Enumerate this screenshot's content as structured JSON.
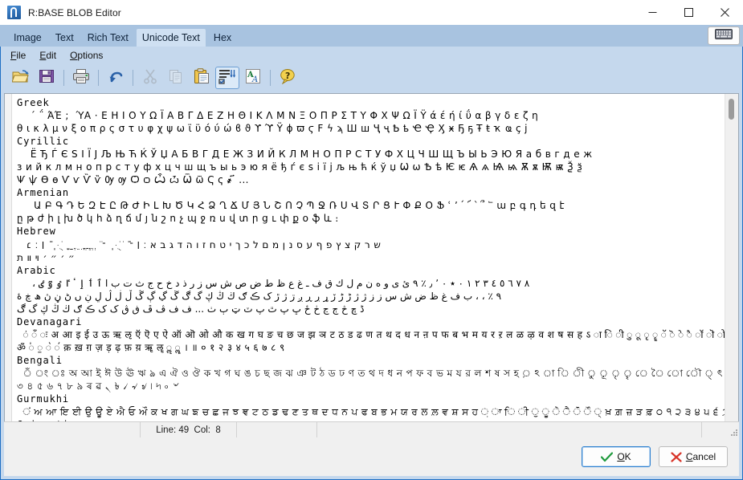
{
  "window": {
    "title": "R:BASE BLOB Editor",
    "icon": "rbase-logo-icon",
    "controls": {
      "minimize": "minimize-button",
      "maximize": "maximize-button",
      "close": "close-button"
    }
  },
  "tabs": [
    {
      "label": "Image",
      "active": false
    },
    {
      "label": "Text",
      "active": false
    },
    {
      "label": "Rich Text",
      "active": false
    },
    {
      "label": "Unicode Text",
      "active": true
    },
    {
      "label": "Hex",
      "active": false
    }
  ],
  "keyboard_button": "keyboard-icon",
  "menu": [
    {
      "label": "File",
      "accel": "F"
    },
    {
      "label": "Edit",
      "accel": "E"
    },
    {
      "label": "Options",
      "accel": "O"
    }
  ],
  "toolbar": [
    {
      "name": "open-button",
      "title": "Open",
      "disabled": false,
      "pressed": false
    },
    {
      "name": "save-button",
      "title": "Save",
      "disabled": false,
      "pressed": false
    },
    {
      "sep": true
    },
    {
      "name": "print-button",
      "title": "Print",
      "disabled": false,
      "pressed": false
    },
    {
      "sep": true
    },
    {
      "name": "undo-button",
      "title": "Undo",
      "disabled": false,
      "pressed": false
    },
    {
      "sep": true
    },
    {
      "name": "cut-button",
      "title": "Cut",
      "disabled": true,
      "pressed": false
    },
    {
      "name": "copy-button",
      "title": "Copy",
      "disabled": true,
      "pressed": false
    },
    {
      "name": "paste-button",
      "title": "Paste",
      "disabled": false,
      "pressed": false
    },
    {
      "name": "spell-check-button",
      "title": "Spell Check",
      "disabled": false,
      "pressed": true
    },
    {
      "name": "font-button",
      "title": "Font",
      "disabled": false,
      "pressed": false
    },
    {
      "sep": true
    },
    {
      "name": "help-button",
      "title": "Help",
      "disabled": false,
      "pressed": false
    }
  ],
  "editor": {
    "lines": [
      {
        "text": "Greek",
        "style": "hdr"
      },
      {
        "text": "    ΄ ΅ ΆΈ ; ΍ ΎΑ · Ε Η Ι Ο Υ Ω Ϊ Α Β Γ Δ Ε Ζ Η Θ Ι Κ Λ Μ Ν Ξ Ο Π Ρ Σ Τ Υ Φ Χ Ψ Ω Ϊ Ϋ ά έ ή ί ΰ α β γ δ ε ζ η",
        "style": "uni"
      },
      {
        "text": "θ ι κ λ μ ν ξ ο π ρ ς σ τ υ φ χ ψ ω ϊ ϋ ό ύ ώ ϐ ϑ ϒ ϓ Ϋ ϕ ϖ ϛ Ϝ ϟ ϡ Ш ш Ҷ ҷ Ҍ ҍ Ҽ Ҿ Ӽ ӿ Ҕ ҕ Ŧ ŧ ҡ ҩ ҫ ј",
        "style": "uni"
      },
      {
        "text": "Cyrillic",
        "style": "hdr"
      },
      {
        "text": "    Ё Ђ Ѓ Є Ѕ І Ї Ј Љ Њ Ћ Ќ Ў Џ А Б В Г Д Е Ж З И Й К Л М Н О П Р С Т У Ф Х Ц Ч Ш Щ Ъ Ы Ь Э Ю Я а б в г д е ж",
        "style": "uni"
      },
      {
        "text": "з и й к л м н о п р с т у ф х ц ч ш щ ъ ы ь э ю я ё ђ ѓ є ѕ і ї ј љ њ ћ ќ ў џ Ѡ ѡ Ѣ ѣ Ѥ ѥ Ѧ ѧ Ѩ ѩ Ѫ ѫ Ѭ ѭ Ѯ ѯ",
        "style": "uni"
      },
      {
        "text": "Ѱ ѱ Ѳ ѳ Ѵ ѵ Ѷ ѷ Ѹ ѹ Ѻ ѻ Ѽ ѽ Ѿ ѿ Ҁ ҁ ҂ ҃ ...",
        "style": "uni"
      },
      {
        "text": "Armenian",
        "style": "hdr"
      },
      {
        "text": "     Ա Բ Գ Դ Ե Զ Է Ը Թ Ժ Ի Լ Խ Ծ Կ Հ Ձ Ղ Ճ Մ Յ Ն Շ Ո Չ Պ Ջ Ռ Ս Վ Տ Ր Ց Ւ Փ Ք Օ Ֆ ՙ ՚ ՛ ՜ ՝ ՞ ՟ ա բ գ դ ե զ է",
        "style": "uni"
      },
      {
        "text": "ը թ ժ ի լ խ ծ կ հ ձ ղ ճ մ յ ն շ ո չ պ ջ ռ ս վ տ ր ց ւ փ ք օ ֆ և ։",
        "style": "uni"
      },
      {
        "text": "Hebrew",
        "style": "hdr"
      },
      {
        "text": "   ש ר ק צ ץ פ ף ע ס נ ן מ ם ל כ ך י ט ח ז ו ה ד ג ב א ׃ ׀ ־ ֿ ֹ ֺ ֻ ּ ֽ ־ ׂ ׁ ְ ֱ ֲ ֳ ִ ֵ ֶ ַ ָ ֹ ֻ ּ ֽ ֿ ׀ ׃ ׆",
        "style": "uni"
      },
      {
        "text": "״ ׳ ״ ׳ ױ װ ת",
        "style": "uni"
      },
      {
        "text": "Arabic",
        "style": "hdr"
      },
      {
        "text": "     ، ٨ ٧ ٦ ٥ ٤ ٣ ٢ ١ ٠ ٭ ۰ ٬ ٫ ٪ ٩ ئ ى و ه ن م ل ك ق ف ـ غ ع ظ ط ض ص ش س ز ر ذ د خ ح ج ث ت ب ا ٱ ٲ ٳ ٴ ٵ ٶ ٷ ٸ",
        "style": "uni"
      },
      {
        "text": "٩ ٪ ، ، ب ف غ ظ ض ش س ز ز ژ ژ ڑ ڑ ڒ ړ ڔ ڕ ږ ڗ ژ ڙ ک ڪ ګ ڬ ڭ ڮ گ ڰ ڱ ڲ ڳ ڴ ڵ ڶ ڷ ڸ ڹ ں ڻ ڼ ڽ ھ ڿ ۀ",
        "style": "uni"
      },
      {
        "text": "ڈ ڇ څ ڄ ڃ ڂ ځ ڀ پ ٿ پ ٽ ټ ٻ ٺ ... ف ف ڤ ڦ ڧ ڨ ک ک ڪ ګ ڬ ڭ ڮ گ ڰ",
        "style": "uni"
      },
      {
        "text": "Devanagari",
        "style": "hdr"
      },
      {
        "text": "  ं ँ ः अ आ इ ई उ ऊ ऋ ऌ ऍ ऎ ए ऐ ऑ ऒ ओ औ क ख ग घ ङ च छ ज झ ञ ट ठ ड ढ ण त थ द ध न ऩ प फ ब भ म य र ऱ ल ळ ऴ व श ष स ह ऽ ा ि ी ु ू ृ ॄ ॅ ॆ े ै ॉ ॊ ो ौ ्",
        "style": "uni"
      },
      {
        "text": "ॐ ॑ ॒ ॓ ॔ क़ ख़ ग़ ज़ ड़ ढ़ फ़ य़ ॠ ॡ ॢ ॣ । ॥ ० १ २ ३ ४ ५ ६ ७ ८ ९",
        "style": "uni"
      },
      {
        "text": "Bengali",
        "style": "hdr"
      },
      {
        "text": "  ঁ ং ঃ অ আ ই ঈ উ ঊ ঋ ঌ এ ঐ ও ঔ ক খ গ ঘ ঙ চ ছ জ ঝ ঞ ট ঠ ড ঢ ণ ত থ দ ধ ন প ফ ব ভ ম য র ল শ ষ স হ ় ঽ া ি ী ু ূ ৃ ৄ ে ৈ ো ৌ ্ ৎ",
        "style": "uni"
      },
      {
        "text": "৩ ৪ ৫ ৬ ৭ ৮ ৯ ৰ ৱ ৲ ৳ ৴ ৵ ৶ ৷ ৸ ৹ ৺",
        "style": "uni"
      },
      {
        "text": "Gurmukhi",
        "style": "hdr"
      },
      {
        "text": "  ਂ ਅ ਆ ਇ ਈ ਉ ਊ ਏ ਐ ਓ ਔ ਕ ਖ ਗ ਘ ਙ ਚ ਛ ਜ ਝ ਞ ਟ ਠ ਡ ਢ ਣ ਤ ਥ ਦ ਧ ਨ ਪ ਫ ਬ ਭ ਮ ਯ ਰ ਲ ਲ਼ ਵ ਸ਼ ਸ ਹ ਼ ਾ ਿ ੀ ੁ ੂ ੇ ੈ ੋ ੌ ੍ ਖ਼ ਗ਼ ਜ਼ ੜ ਫ਼ ੦ ੧ ੨ ੩ ੪ ੫ ੬ ੭ ੮ ੯ ੰ ੱ ੲ ੳ ੴ",
        "style": "uni"
      },
      {
        "text": "Gujarati",
        "style": "hdr"
      }
    ],
    "scrollbar": {
      "name": "vertical-scrollbar",
      "thumb_top_pct": 2
    }
  },
  "statusbar": {
    "line_label": "Line:",
    "line_value": "49",
    "col_label": "Col:",
    "col_value": "8",
    "text": "Line: 49  Col:  8"
  },
  "buttons": {
    "ok": {
      "label": "OK",
      "accel": "O",
      "icon": "check-icon",
      "default": true
    },
    "cancel": {
      "label": "Cancel",
      "accel": "C",
      "icon": "x-icon",
      "default": false
    }
  },
  "colors": {
    "tabstrip_bg": "#a8c3e0",
    "active_tab_bg": "#cfe0f2",
    "client_bg": "#c5d8ed",
    "border_blue": "#1f6fc4",
    "editor_bg": "#ffffff",
    "status_bg": "#f0f0f0",
    "ok_check": "#1f9a3d",
    "cancel_x": "#d8352a"
  }
}
